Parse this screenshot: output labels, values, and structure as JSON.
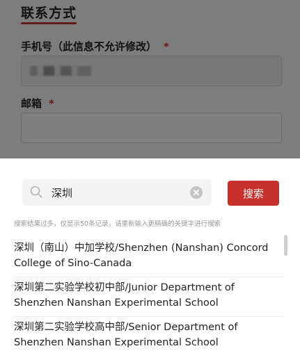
{
  "form": {
    "section_title": "联系方式",
    "phone_label": "手机号（此信息不允许修改）",
    "email_label": "邮箱",
    "required_mark": "*",
    "email_value": ""
  },
  "search": {
    "query": "深圳",
    "button_label": "搜索",
    "hint": "搜索结果过多，仅显示50条记录，请重新输入更精确的关键字进行搜索"
  },
  "results": [
    "深圳（南山）中加学校/Shenzhen (Nanshan) Concord College of Sino-Canada",
    "深圳第二实验学校初中部/Junior Department of Shenzhen Nanshan Experimental School",
    "深圳第二实验学校高中部/Senior Department of Shenzhen Nanshan Experimental School"
  ],
  "colors": {
    "accent": "#c8302c",
    "required": "#d32f2f"
  }
}
